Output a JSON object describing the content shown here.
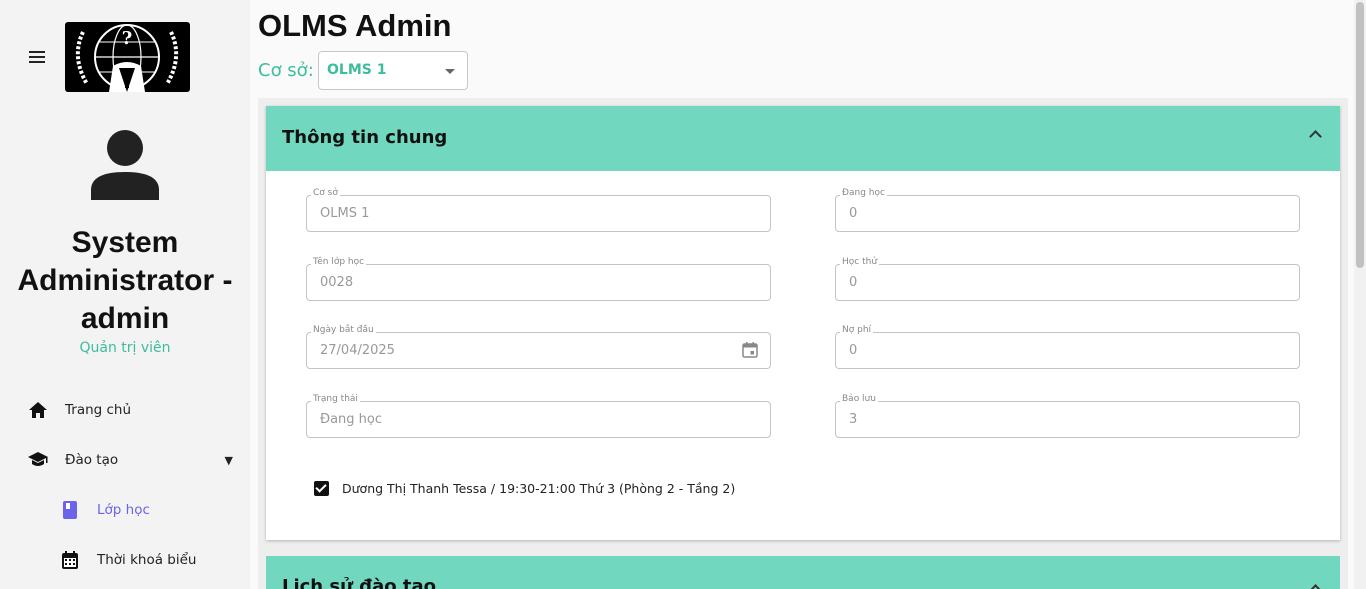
{
  "app": {
    "title": "OLMS Admin"
  },
  "branch": {
    "label": "Cơ sở:",
    "selected": "OLMS 1"
  },
  "sidebar": {
    "user_name": "System Administrator - admin",
    "user_role": "Quản trị viên",
    "items": [
      {
        "label": "Trang chủ",
        "icon": "home-icon"
      },
      {
        "label": "Đào tạo",
        "icon": "graduation-cap-icon",
        "expanded": true
      },
      {
        "label": "Lớp học",
        "icon": "book-icon",
        "active": true
      },
      {
        "label": "Thời khoá biểu",
        "icon": "calendar-icon"
      }
    ]
  },
  "general_panel": {
    "title": "Thông tin chung",
    "fields": {
      "branch": {
        "label": "Cơ sở",
        "value": "OLMS 1"
      },
      "class_name": {
        "label": "Tên lớp học",
        "value": "0028"
      },
      "start_date": {
        "label": "Ngày bắt đầu",
        "value": "27/04/2025"
      },
      "status": {
        "label": "Trạng thái",
        "value": "Đang học"
      },
      "studying": {
        "label": "Đang học",
        "value": "0"
      },
      "trial": {
        "label": "Học thử",
        "value": "0"
      },
      "debt": {
        "label": "Nợ phí",
        "value": "0"
      },
      "reserved": {
        "label": "Bảo lưu",
        "value": "3"
      }
    },
    "schedule_checkbox": {
      "label": "Dương Thị Thanh Tessa / 19:30-21:00 Thứ 3 (Phòng 2 - Tầng 2)",
      "checked": true
    }
  },
  "history_panel": {
    "title": "Lịch sử đào tạo"
  },
  "colors": {
    "accent": "#72d7bf",
    "accent_text": "#3dbd9c",
    "active_nav": "#6b63e8"
  }
}
